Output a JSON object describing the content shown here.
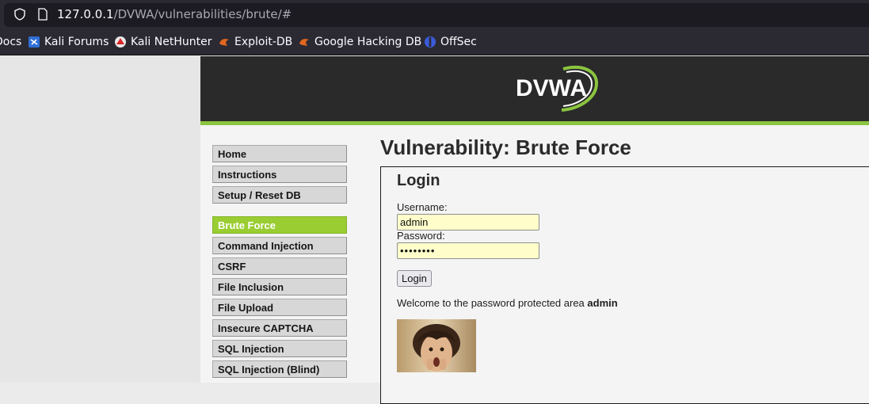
{
  "browser": {
    "url_host": "127.0.0.1",
    "url_path": "/DVWA/vulnerabilities/brute/#",
    "bookmarks": [
      {
        "label": "Docs"
      },
      {
        "label": "Kali Forums"
      },
      {
        "label": "Kali NetHunter"
      },
      {
        "label": "Exploit-DB"
      },
      {
        "label": "Google Hacking DB"
      },
      {
        "label": "OffSec"
      }
    ]
  },
  "site": {
    "logo_text": "DVWA",
    "accent_color": "#8bc53f"
  },
  "menu": {
    "group1": [
      {
        "label": "Home"
      },
      {
        "label": "Instructions"
      },
      {
        "label": "Setup / Reset DB"
      }
    ],
    "group2": [
      {
        "label": "Brute Force",
        "selected": true
      },
      {
        "label": "Command Injection"
      },
      {
        "label": "CSRF"
      },
      {
        "label": "File Inclusion"
      },
      {
        "label": "File Upload"
      },
      {
        "label": "Insecure CAPTCHA"
      },
      {
        "label": "SQL Injection"
      },
      {
        "label": "SQL Injection (Blind)"
      }
    ]
  },
  "main": {
    "title": "Vulnerability: Brute Force",
    "login_heading": "Login",
    "username_label": "Username:",
    "username_value": "admin",
    "password_label": "Password:",
    "password_masked": "••••••••",
    "login_button": "Login",
    "welcome_text": "Welcome to the password protected area",
    "welcome_user": "admin"
  }
}
